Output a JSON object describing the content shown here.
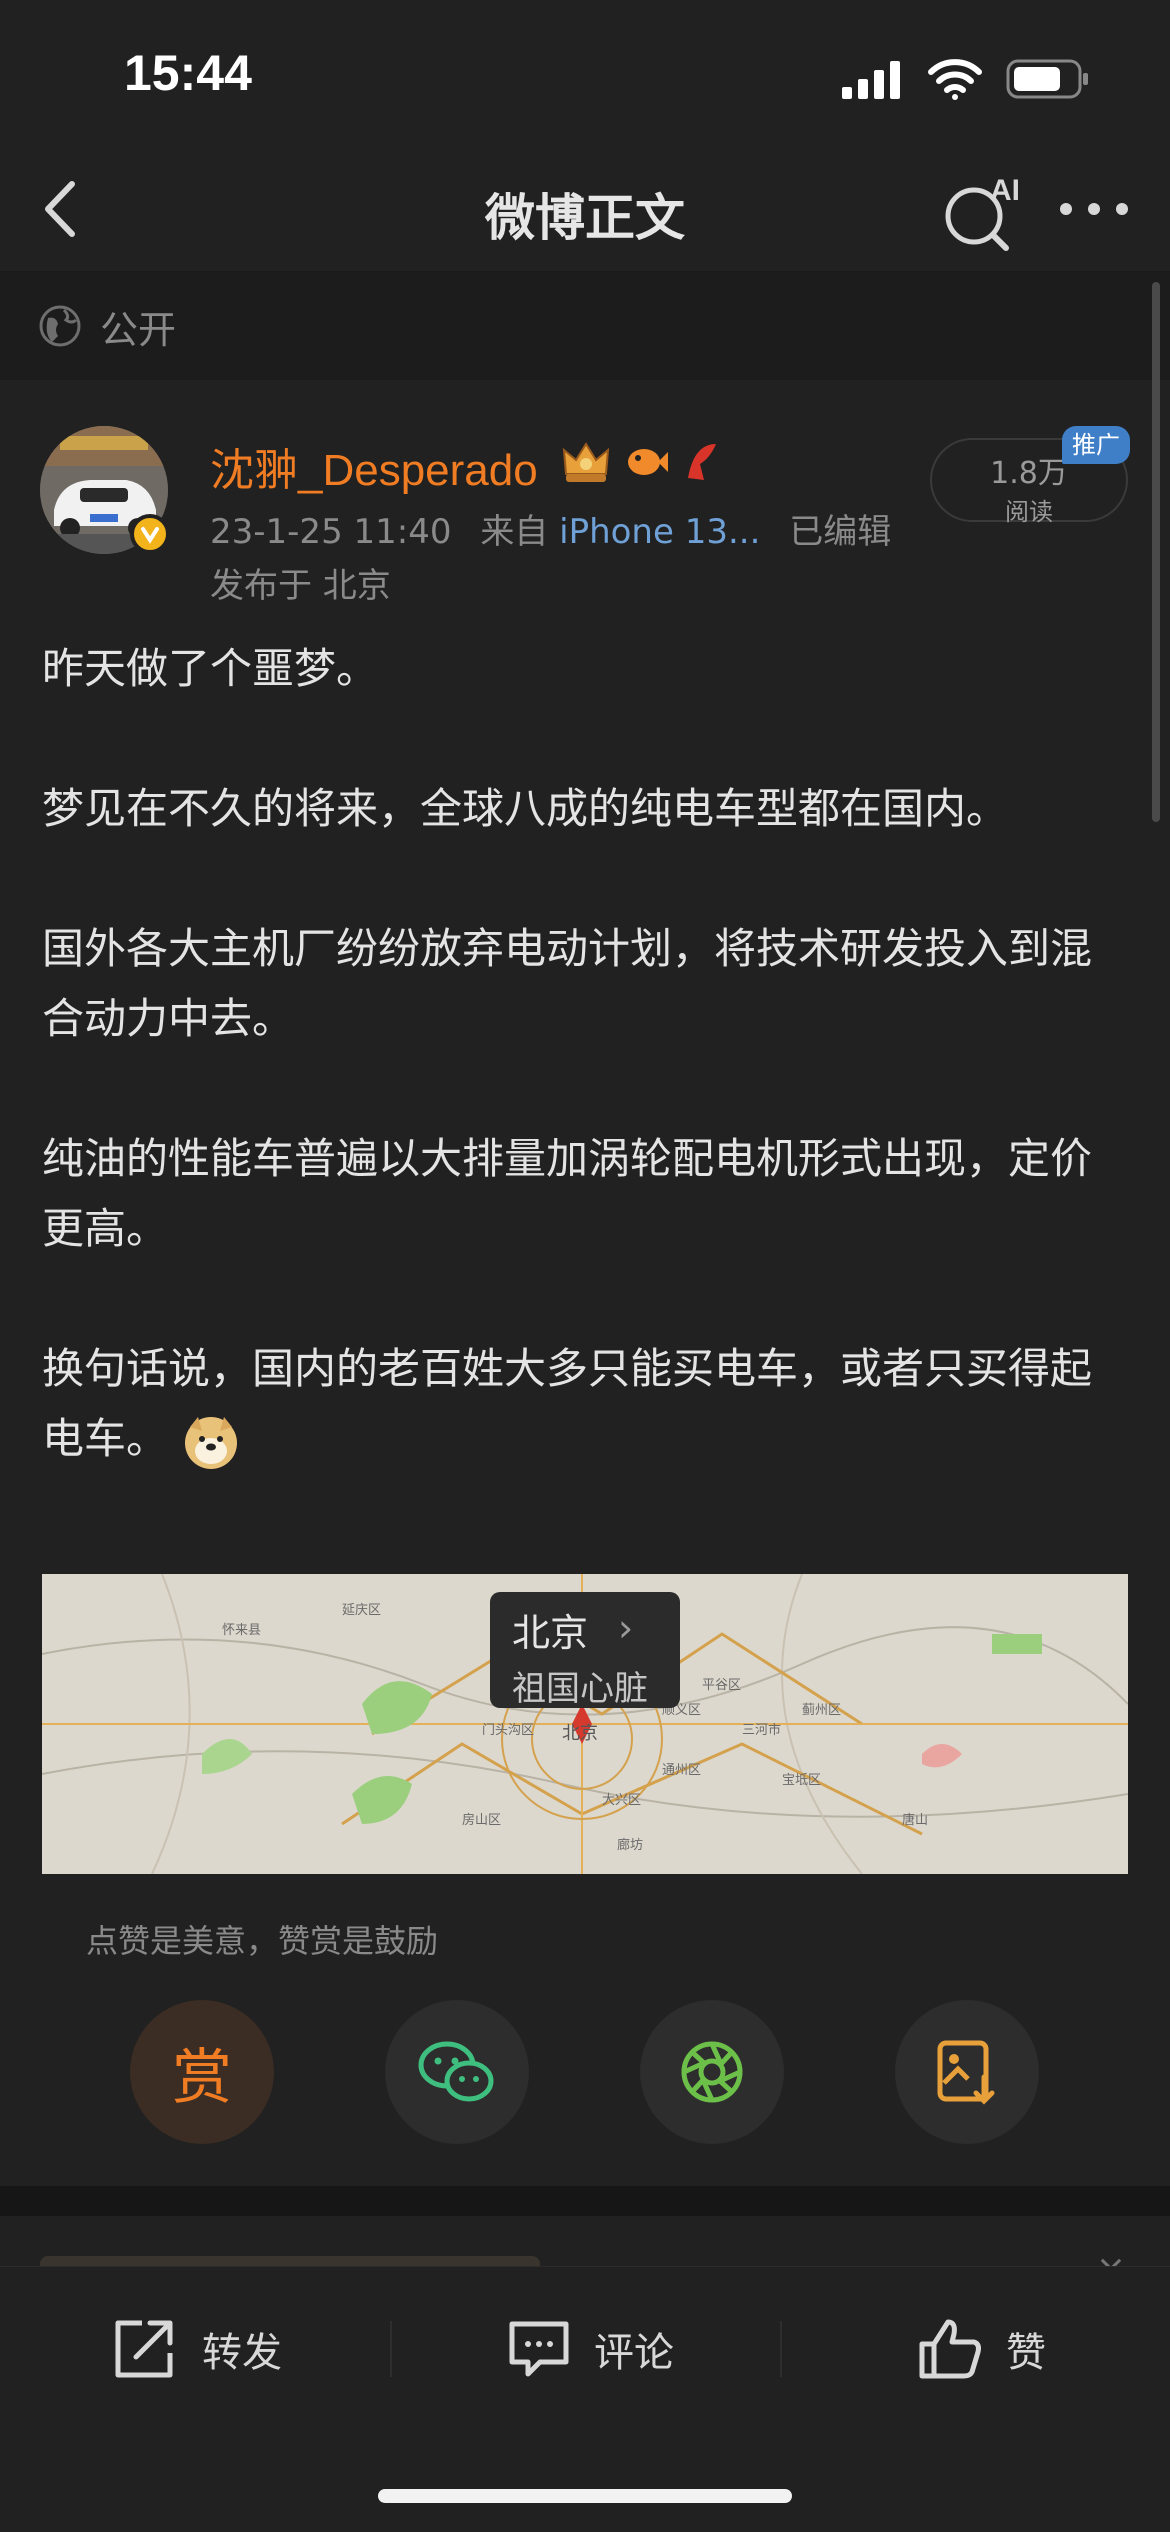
{
  "status_bar": {
    "time": "15:44"
  },
  "nav": {
    "title": "微博正文",
    "ai_badge": "AI"
  },
  "visibility": {
    "label": "公开"
  },
  "post": {
    "username": "沈翀_Desperado",
    "timestamp": "23-1-25 11:40",
    "source_prefix": "来自",
    "device": "iPhone 13...",
    "edited": "已编辑",
    "location": "发布于 北京",
    "read_count": "1.8万",
    "read_label": "阅读",
    "promo_tag": "推广",
    "paragraphs": [
      "昨天做了个噩梦。",
      "梦见在不久的将来，全球八成的纯电车型都在国内。",
      "国外各大主机厂纷纷放弃电动计划，将技术研发投入到混合动力中去。",
      "纯油的性能车普遍以大排量加涡轮配电机形式出现，定价更高。",
      "换句话说，国内的老百姓大多只能买电车，或者只买得起电车。"
    ]
  },
  "map": {
    "city": "北京",
    "description": "祖国心脏",
    "labels": [
      "北京",
      "门头沟区",
      "平谷区",
      "顺义区",
      "通州区",
      "大兴区",
      "房山区",
      "廊坊",
      "唐山",
      "三河市",
      "蓟州区",
      "宝坻区",
      "怀来县",
      "延庆区"
    ]
  },
  "reward": {
    "hint": "点赞是美意，赞赏是鼓励",
    "reward_char": "赏",
    "buttons": [
      "reward",
      "wechat",
      "moments",
      "save-image"
    ]
  },
  "toolbar": {
    "repost": "转发",
    "comment": "评论",
    "like": "赞"
  },
  "colors": {
    "background": "#212121",
    "accent_orange": "#f07c23",
    "link_blue": "#6fa0d6",
    "wechat_green": "#3fbf7f",
    "moments_green": "#6cc04a",
    "save_orange": "#e8a13a"
  }
}
